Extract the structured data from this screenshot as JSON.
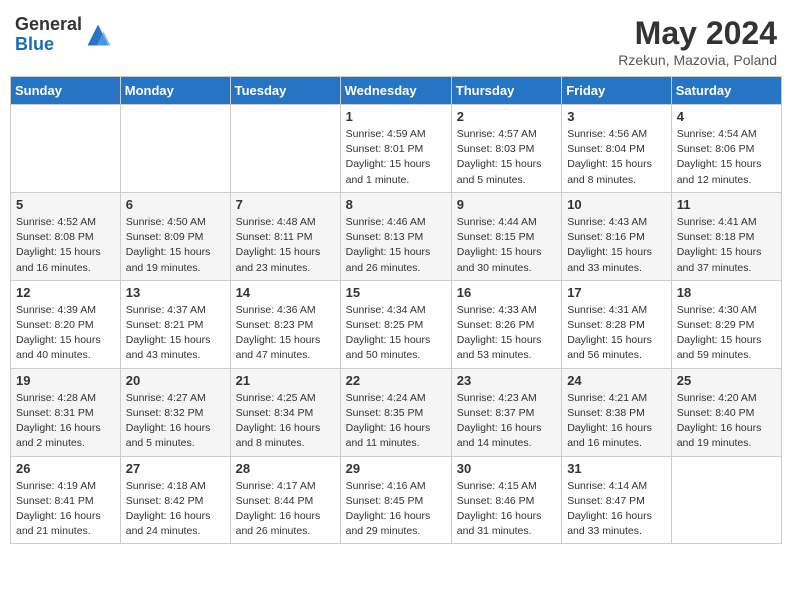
{
  "header": {
    "logo_general": "General",
    "logo_blue": "Blue",
    "main_title": "May 2024",
    "subtitle": "Rzekun, Mazovia, Poland"
  },
  "weekdays": [
    "Sunday",
    "Monday",
    "Tuesday",
    "Wednesday",
    "Thursday",
    "Friday",
    "Saturday"
  ],
  "weeks": [
    [
      {
        "day": "",
        "info": ""
      },
      {
        "day": "",
        "info": ""
      },
      {
        "day": "",
        "info": ""
      },
      {
        "day": "1",
        "info": "Sunrise: 4:59 AM\nSunset: 8:01 PM\nDaylight: 15 hours and 1 minute."
      },
      {
        "day": "2",
        "info": "Sunrise: 4:57 AM\nSunset: 8:03 PM\nDaylight: 15 hours and 5 minutes."
      },
      {
        "day": "3",
        "info": "Sunrise: 4:56 AM\nSunset: 8:04 PM\nDaylight: 15 hours and 8 minutes."
      },
      {
        "day": "4",
        "info": "Sunrise: 4:54 AM\nSunset: 8:06 PM\nDaylight: 15 hours and 12 minutes."
      }
    ],
    [
      {
        "day": "5",
        "info": "Sunrise: 4:52 AM\nSunset: 8:08 PM\nDaylight: 15 hours and 16 minutes."
      },
      {
        "day": "6",
        "info": "Sunrise: 4:50 AM\nSunset: 8:09 PM\nDaylight: 15 hours and 19 minutes."
      },
      {
        "day": "7",
        "info": "Sunrise: 4:48 AM\nSunset: 8:11 PM\nDaylight: 15 hours and 23 minutes."
      },
      {
        "day": "8",
        "info": "Sunrise: 4:46 AM\nSunset: 8:13 PM\nDaylight: 15 hours and 26 minutes."
      },
      {
        "day": "9",
        "info": "Sunrise: 4:44 AM\nSunset: 8:15 PM\nDaylight: 15 hours and 30 minutes."
      },
      {
        "day": "10",
        "info": "Sunrise: 4:43 AM\nSunset: 8:16 PM\nDaylight: 15 hours and 33 minutes."
      },
      {
        "day": "11",
        "info": "Sunrise: 4:41 AM\nSunset: 8:18 PM\nDaylight: 15 hours and 37 minutes."
      }
    ],
    [
      {
        "day": "12",
        "info": "Sunrise: 4:39 AM\nSunset: 8:20 PM\nDaylight: 15 hours and 40 minutes."
      },
      {
        "day": "13",
        "info": "Sunrise: 4:37 AM\nSunset: 8:21 PM\nDaylight: 15 hours and 43 minutes."
      },
      {
        "day": "14",
        "info": "Sunrise: 4:36 AM\nSunset: 8:23 PM\nDaylight: 15 hours and 47 minutes."
      },
      {
        "day": "15",
        "info": "Sunrise: 4:34 AM\nSunset: 8:25 PM\nDaylight: 15 hours and 50 minutes."
      },
      {
        "day": "16",
        "info": "Sunrise: 4:33 AM\nSunset: 8:26 PM\nDaylight: 15 hours and 53 minutes."
      },
      {
        "day": "17",
        "info": "Sunrise: 4:31 AM\nSunset: 8:28 PM\nDaylight: 15 hours and 56 minutes."
      },
      {
        "day": "18",
        "info": "Sunrise: 4:30 AM\nSunset: 8:29 PM\nDaylight: 15 hours and 59 minutes."
      }
    ],
    [
      {
        "day": "19",
        "info": "Sunrise: 4:28 AM\nSunset: 8:31 PM\nDaylight: 16 hours and 2 minutes."
      },
      {
        "day": "20",
        "info": "Sunrise: 4:27 AM\nSunset: 8:32 PM\nDaylight: 16 hours and 5 minutes."
      },
      {
        "day": "21",
        "info": "Sunrise: 4:25 AM\nSunset: 8:34 PM\nDaylight: 16 hours and 8 minutes."
      },
      {
        "day": "22",
        "info": "Sunrise: 4:24 AM\nSunset: 8:35 PM\nDaylight: 16 hours and 11 minutes."
      },
      {
        "day": "23",
        "info": "Sunrise: 4:23 AM\nSunset: 8:37 PM\nDaylight: 16 hours and 14 minutes."
      },
      {
        "day": "24",
        "info": "Sunrise: 4:21 AM\nSunset: 8:38 PM\nDaylight: 16 hours and 16 minutes."
      },
      {
        "day": "25",
        "info": "Sunrise: 4:20 AM\nSunset: 8:40 PM\nDaylight: 16 hours and 19 minutes."
      }
    ],
    [
      {
        "day": "26",
        "info": "Sunrise: 4:19 AM\nSunset: 8:41 PM\nDaylight: 16 hours and 21 minutes."
      },
      {
        "day": "27",
        "info": "Sunrise: 4:18 AM\nSunset: 8:42 PM\nDaylight: 16 hours and 24 minutes."
      },
      {
        "day": "28",
        "info": "Sunrise: 4:17 AM\nSunset: 8:44 PM\nDaylight: 16 hours and 26 minutes."
      },
      {
        "day": "29",
        "info": "Sunrise: 4:16 AM\nSunset: 8:45 PM\nDaylight: 16 hours and 29 minutes."
      },
      {
        "day": "30",
        "info": "Sunrise: 4:15 AM\nSunset: 8:46 PM\nDaylight: 16 hours and 31 minutes."
      },
      {
        "day": "31",
        "info": "Sunrise: 4:14 AM\nSunset: 8:47 PM\nDaylight: 16 hours and 33 minutes."
      },
      {
        "day": "",
        "info": ""
      }
    ]
  ]
}
